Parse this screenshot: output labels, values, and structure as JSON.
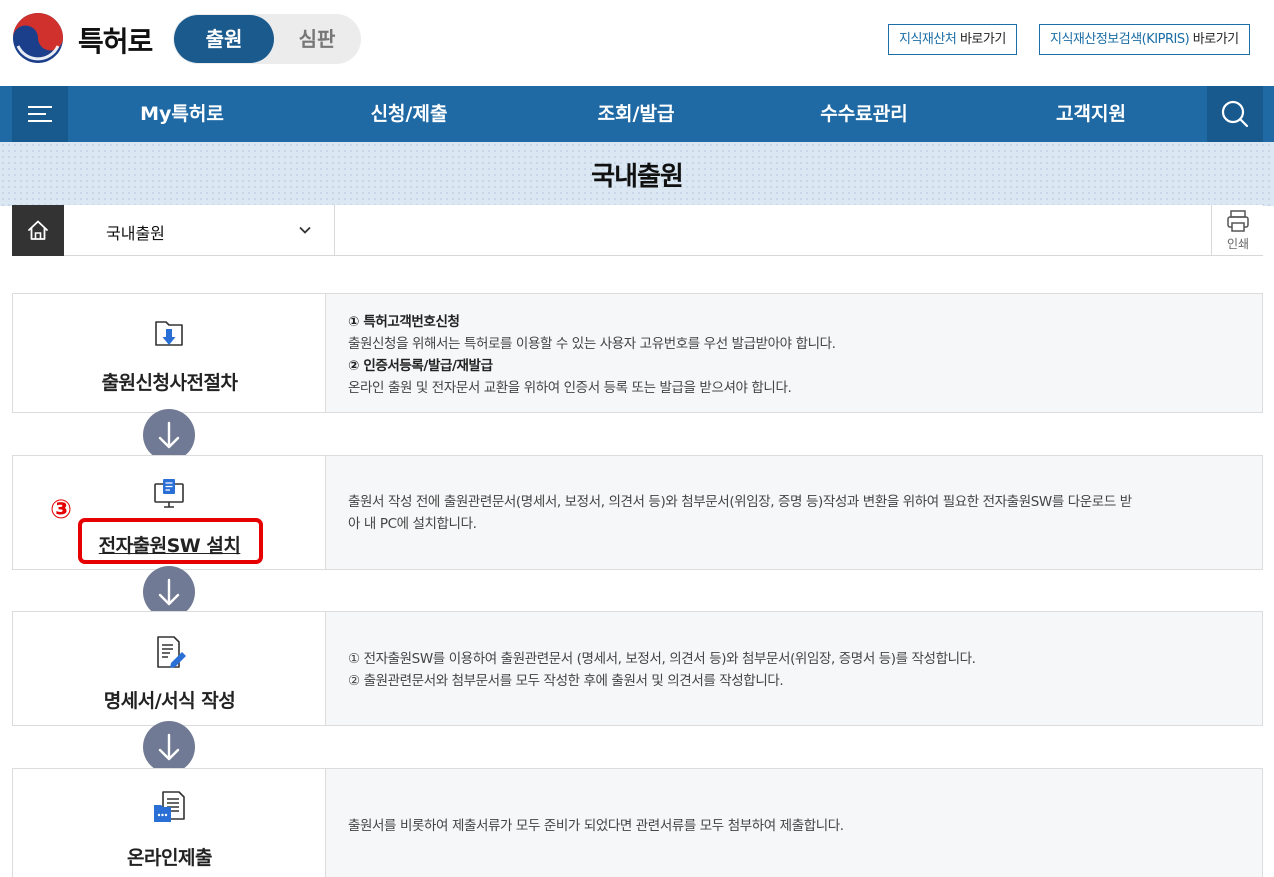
{
  "header": {
    "logo_text": "특허로",
    "segment_active": "출원",
    "segment_inactive": "심판",
    "quick_links": [
      {
        "em": "지식재산처",
        "rest": " 바로가기"
      },
      {
        "em": "지식재산정보검색(KIPRIS)",
        "rest": " 바로가기"
      }
    ]
  },
  "nav": {
    "items": [
      "My특허로",
      "신청/제출",
      "조회/발급",
      "수수료관리",
      "고객지원"
    ]
  },
  "page": {
    "title": "국내출원"
  },
  "breadcrumb": {
    "selected": "국내출원",
    "print_label": "인쇄"
  },
  "steps": [
    {
      "name": "출원신청사전절차",
      "lines": [
        {
          "bold": true,
          "text": "① 특허고객번호신청"
        },
        {
          "bold": false,
          "text": "출원신청을 위해서는 특허로를 이용할 수 있는 사용자 고유번호를 우선 발급받아야 합니다."
        },
        {
          "bold": true,
          "text": "② 인증서등록/발급/재발급"
        },
        {
          "bold": false,
          "text": "온라인 출원 및 전자문서 교환을 위하여 인증서 등록 또는 발급을 받으셔야 합니다."
        }
      ]
    },
    {
      "name": "전자출원SW 설치",
      "lines": [
        {
          "bold": false,
          "text": "출원서 작성 전에 출원관련문서(명세서, 보정서, 의견서 등)와 첨부문서(위임장, 증명 등)작성과 변환을 위하여 필요한 전자출원SW를 다운로드 받"
        },
        {
          "bold": false,
          "text": "아 내 PC에 설치합니다."
        }
      ]
    },
    {
      "name": "명세서/서식 작성",
      "lines": [
        {
          "bold": false,
          "text": "① 전자출원SW를 이용하여 출원관련문서 (명세서, 보정서, 의견서 등)와 첨부문서(위임장, 증명서 등)를 작성합니다."
        },
        {
          "bold": false,
          "text": "② 출원관련문서와 첨부문서를 모두 작성한 후에 출원서 및 의견서를 작성합니다."
        }
      ]
    },
    {
      "name": "온라인제출",
      "lines": [
        {
          "bold": false,
          "text": "출원서를 비롯하여 제출서류가 모두 준비가 되었다면 관련서류를 모두 첨부하여 제출합니다."
        }
      ]
    }
  ],
  "annotation": {
    "number": "③"
  },
  "colors": {
    "brand": "#1f6aa5",
    "brand_dark": "#1b5a8d",
    "arrow_circle": "#717a94",
    "highlight": "#e60000"
  }
}
